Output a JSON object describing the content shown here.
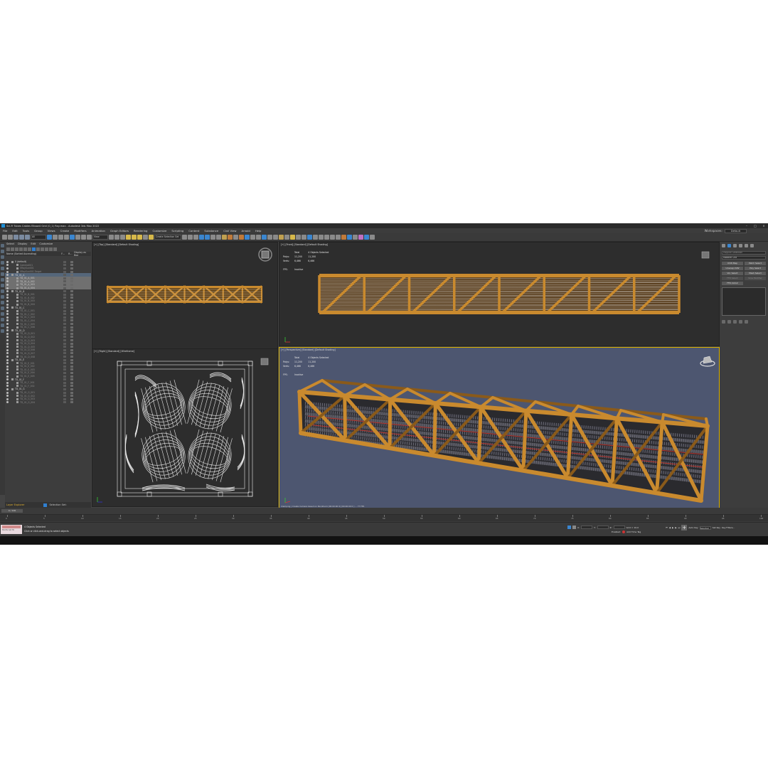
{
  "window": {
    "title": "Sci-Fi Tubes Cables Elbow4 Grid (0_1) Ray.max - Autodesk 3ds Max 2022"
  },
  "menu": [
    "File",
    "Edit",
    "Tools",
    "Group",
    "Views",
    "Create",
    "Modifiers",
    "Animation",
    "Graph Editors",
    "Rendering",
    "Customize",
    "Scripting",
    "Content",
    "Substance",
    "Civil View",
    "Arnold",
    "Help"
  ],
  "workspace": {
    "label": "Workspaces:",
    "value": "Default"
  },
  "toolbar": {
    "view_select": "View",
    "selection_set": "Create Selection Set"
  },
  "explorer": {
    "tabs": [
      "Select",
      "Display",
      "Edit",
      "Customize"
    ],
    "columns": [
      "Name (Sorted Ascending)",
      "F...",
      "R...",
      "Display as Box"
    ],
    "rows": [
      {
        "name": "0 (default)",
        "state": "normal"
      },
      {
        "name": "Camera001",
        "state": "dim"
      },
      {
        "name": "VRaySun001",
        "state": "dim"
      },
      {
        "name": "VRaySun001.Target",
        "state": "dim"
      },
      {
        "name": "TD_01_A",
        "state": "hl"
      },
      {
        "name": "TD_01_A_001",
        "state": "sel"
      },
      {
        "name": "TD_01_A_002",
        "state": "sel"
      },
      {
        "name": "TD_01_A_003",
        "state": "sel"
      },
      {
        "name": "TD_01_A_004",
        "state": "sel"
      },
      {
        "name": "TD_01_B",
        "state": "normal"
      },
      {
        "name": "TD_01_B_001",
        "state": "dim"
      },
      {
        "name": "TD_01_B_002",
        "state": "dim"
      },
      {
        "name": "TD_01_B_003",
        "state": "dim"
      },
      {
        "name": "TD_01_B_004",
        "state": "dim"
      },
      {
        "name": "TD_01_C",
        "state": "normal"
      },
      {
        "name": "TD_01_C_001",
        "state": "dim"
      },
      {
        "name": "TD_01_C_002",
        "state": "dim"
      },
      {
        "name": "TD_01_C_003",
        "state": "dim"
      },
      {
        "name": "TD_01_C_004",
        "state": "dim"
      },
      {
        "name": "TD_01_C_005",
        "state": "dim"
      },
      {
        "name": "TD_01_C_006",
        "state": "dim"
      },
      {
        "name": "TD_01_D",
        "state": "normal"
      },
      {
        "name": "TD_01_D_001",
        "state": "dim"
      },
      {
        "name": "TD_01_D_002",
        "state": "dim"
      },
      {
        "name": "TD_01_D_003",
        "state": "dim"
      },
      {
        "name": "TD_01_D_004",
        "state": "dim"
      },
      {
        "name": "TD_01_D_005",
        "state": "dim"
      },
      {
        "name": "TD_01_D_006",
        "state": "dim"
      },
      {
        "name": "TD_01_D_007",
        "state": "dim"
      },
      {
        "name": "TD_01_D_008",
        "state": "dim"
      },
      {
        "name": "TD_01_E",
        "state": "normal"
      },
      {
        "name": "TD_01_E_001",
        "state": "dim"
      },
      {
        "name": "TD_01_E_002",
        "state": "dim"
      },
      {
        "name": "TD_01_E_003",
        "state": "dim"
      },
      {
        "name": "TD_01_E_004",
        "state": "dim"
      },
      {
        "name": "TD_01_E_005",
        "state": "dim"
      },
      {
        "name": "TD_01_F",
        "state": "normal"
      },
      {
        "name": "TD_01_F_001",
        "state": "dim"
      },
      {
        "name": "TD_01_F_002",
        "state": "dim"
      },
      {
        "name": "TD_01_G",
        "state": "normal"
      },
      {
        "name": "TD_01_G_001",
        "state": "dim"
      },
      {
        "name": "TD_01_G_002",
        "state": "dim"
      },
      {
        "name": "TD_01_G_003",
        "state": "dim"
      },
      {
        "name": "TD_01_G_004",
        "state": "dim"
      }
    ],
    "layer_label": "Layer Explorer",
    "selection_set_label": "Selection Set:"
  },
  "viewports": {
    "top": {
      "label": "[+] [Top] [Standard] [Default Shading]"
    },
    "front": {
      "label": "[+] [Front] [Standard] [Default Shading]"
    },
    "right": {
      "label": "[+] [Right] [Standard] [Wireframe]"
    },
    "persp": {
      "label": "[+] [Perspective] [Standard] [Default Shading]"
    }
  },
  "stats": {
    "header_total": "Total",
    "header_sel": "4 Objects Selected",
    "polys_label": "Polys:",
    "polys_total": "11,200",
    "polys_sel": "11,200",
    "verts_label": "Verts:",
    "verts_total": "6,466",
    "verts_sel": "6,466",
    "fps_label": "FPS:",
    "fps_value": "Inactive"
  },
  "persp_footer": "Clamping | Create Camera based on Pan/Zoom [00:00:00 0] [00:00:00 0 ] ... 77 FPS",
  "command_panel": {
    "search": "Polyline Selection",
    "modifier_list": "Modifier List",
    "buttons": [
      "UVW Map",
      "Patch Select",
      "Unwrap UVW",
      "Poly Select",
      "Vol. Select",
      "Mesh Select",
      "FFD Select",
      "Slice Modifier",
      "FFD 2x2x2"
    ]
  },
  "timeline": {
    "frame": "0 / 100",
    "ticks": [
      "0",
      "5",
      "10",
      "15",
      "20",
      "25",
      "30",
      "35",
      "40",
      "45",
      "50",
      "55",
      "60",
      "65",
      "70",
      "75",
      "80",
      "85",
      "90",
      "95",
      "100"
    ]
  },
  "status": {
    "line1": "4 Objects Selected",
    "line2": "Click or click-and-drag to select objects",
    "maxscript": "MAXScript Mi",
    "x_label": "X:",
    "y_label": "Y:",
    "z_label": "Z:",
    "grid": "Grid = 10.0",
    "enabled": "Enabled:",
    "add_time_tag": "Add Time Tag",
    "auto_key": "Auto Key",
    "set_key": "Set Key",
    "selected": "Selected",
    "key_filters": "Key Filters..."
  },
  "colors": {
    "bg": "#444444",
    "viewport_bg": "#2d2d2d",
    "persp_bg": "#4d5670",
    "truss": "#c98a2e",
    "truss_dark": "#8a5a1a",
    "tube": "#3a3a3a",
    "wire": "#e8e8e8",
    "highlight": "#d8b000"
  }
}
